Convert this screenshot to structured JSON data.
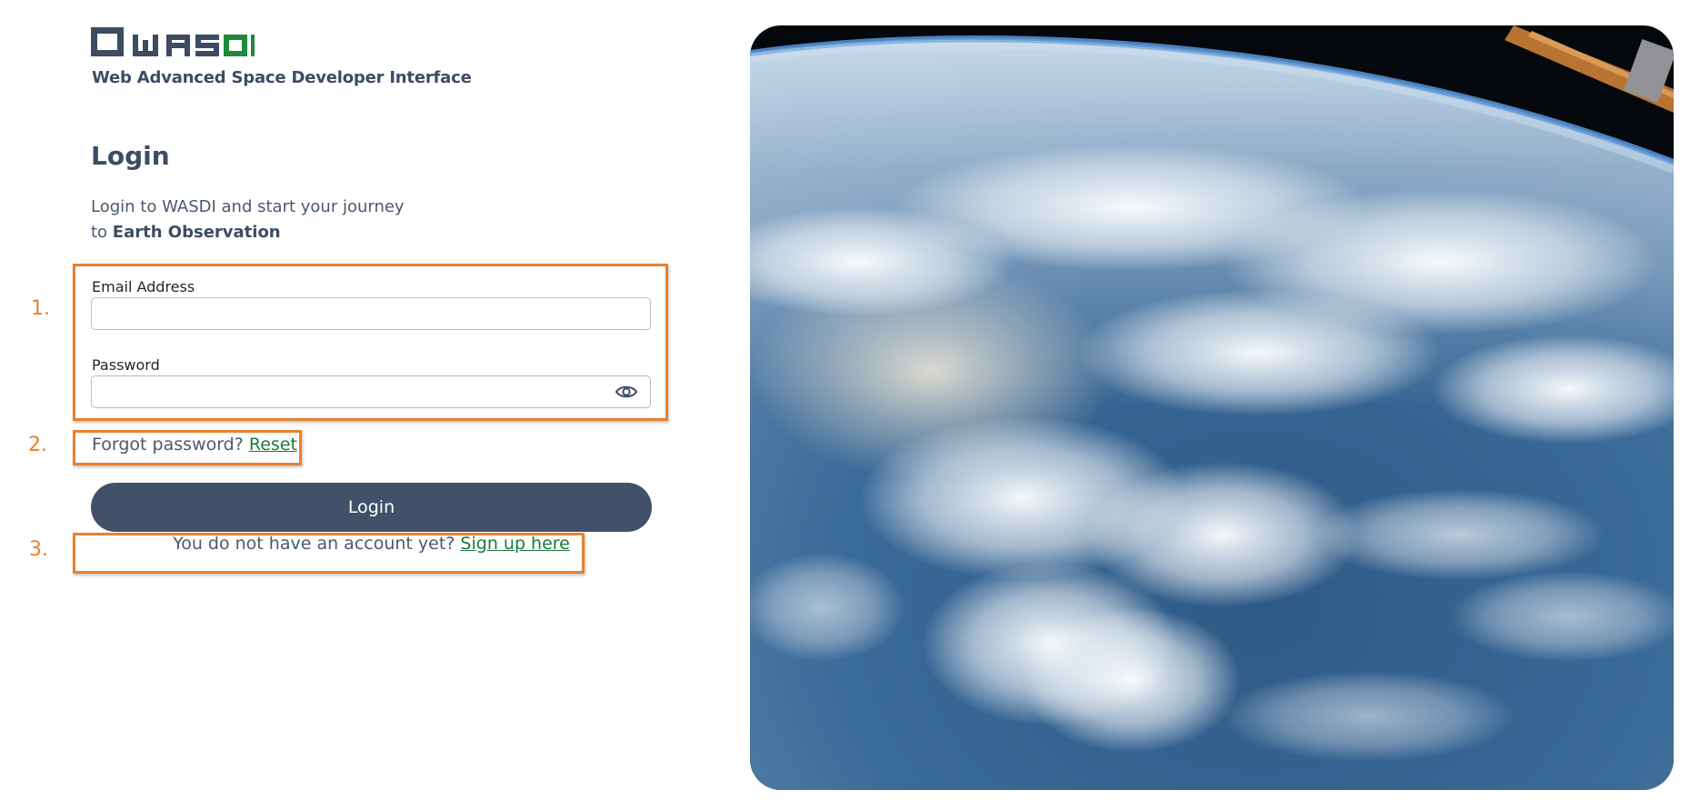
{
  "brand": {
    "logo_text": "WASDI",
    "tagline": "Web Advanced Space Developer Interface",
    "colors": {
      "dark": "#3d4b63",
      "green": "#1f8a3c"
    }
  },
  "login": {
    "title": "Login",
    "subtitle_line1": "Login to WASDI and start your journey",
    "subtitle_prefix": "to ",
    "subtitle_bold": "Earth Observation",
    "email_label": "Email Address",
    "email_value": "",
    "password_label": "Password",
    "password_value": "",
    "forgot_text": "Forgot password? ",
    "reset_link": "Reset",
    "login_button": "Login",
    "signup_text": "You do not have an account yet? ",
    "signup_link": "Sign up here"
  },
  "annotations": {
    "label_1": "1.",
    "label_2": "2.",
    "label_3": "3.",
    "color": "#e8812e"
  },
  "icons": {
    "password_toggle": "eye-icon",
    "hero_image": "earth-from-space"
  }
}
